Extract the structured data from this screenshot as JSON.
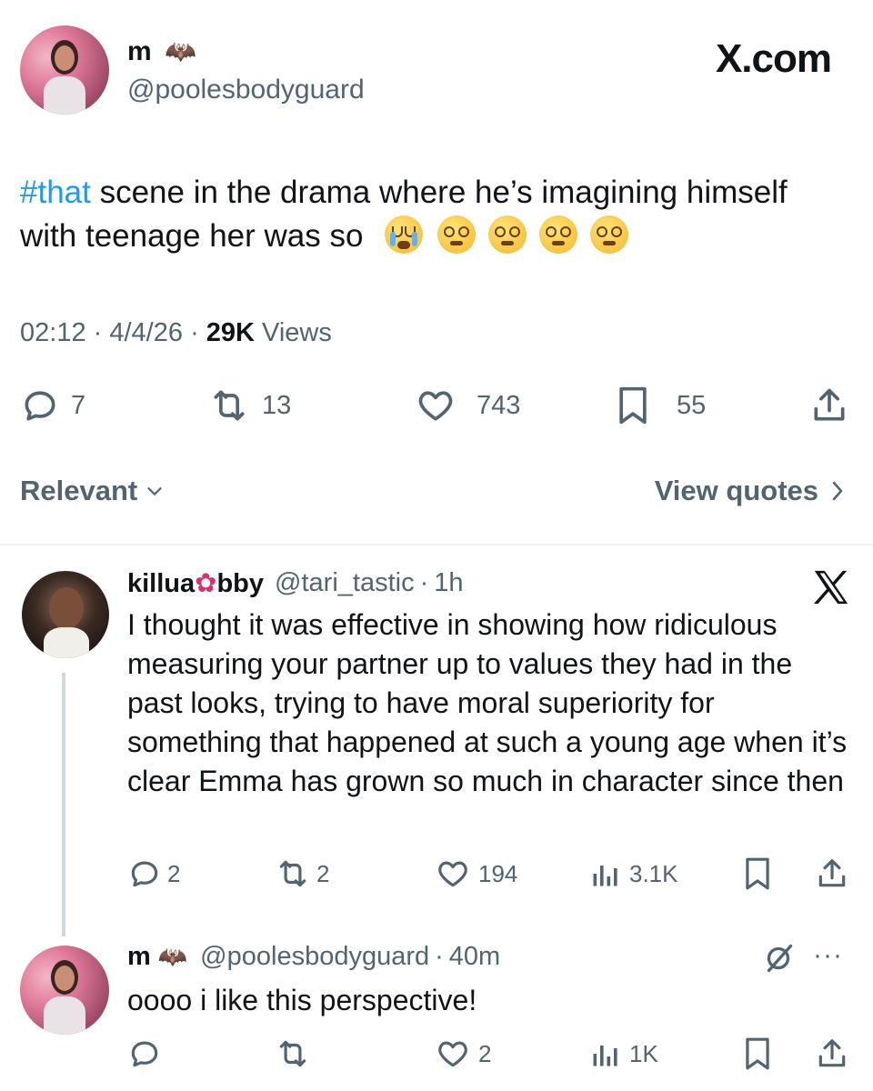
{
  "main_post": {
    "display_name": "m",
    "handle": "@poolesbodyguard",
    "site_logo": "X.com",
    "hashtag": "#that",
    "text_rest": " scene in the drama where he’s imagining himself with teenage her was so",
    "emoji": [
      "loudly-crying-face",
      "face-with-spiral-eyes",
      "face-with-spiral-eyes",
      "face-with-spiral-eyes",
      "face-with-spiral-eyes"
    ],
    "time": "02:12",
    "date": "4/4/26",
    "views_count": "29K",
    "views_label": "Views",
    "replies": "7",
    "reposts": "13",
    "likes": "743",
    "bookmarks": "55"
  },
  "sort_bar": {
    "sort_label": "Relevant",
    "view_quotes": "View quotes"
  },
  "reply_1": {
    "name_part1": "killua",
    "name_part2": "bby",
    "handle": "@tari_tastic",
    "time": "1h",
    "text": "I thought it was effective in showing how ridiculous measuring your partner up to values they had in the past looks, trying to have moral superiority for something that happened at such a young age when it’s clear Emma has grown so much in character since then",
    "replies": "2",
    "reposts": "2",
    "likes": "194",
    "views": "3.1K"
  },
  "reply_2": {
    "display_name": "m",
    "handle": "@poolesbodyguard",
    "time": "40m",
    "text": "oooo i like this perspective!",
    "likes": "2",
    "views": "1K"
  },
  "colors": {
    "accent": "#1d9bf0",
    "secondary_text": "#536471",
    "divider": "#eff3f4"
  }
}
